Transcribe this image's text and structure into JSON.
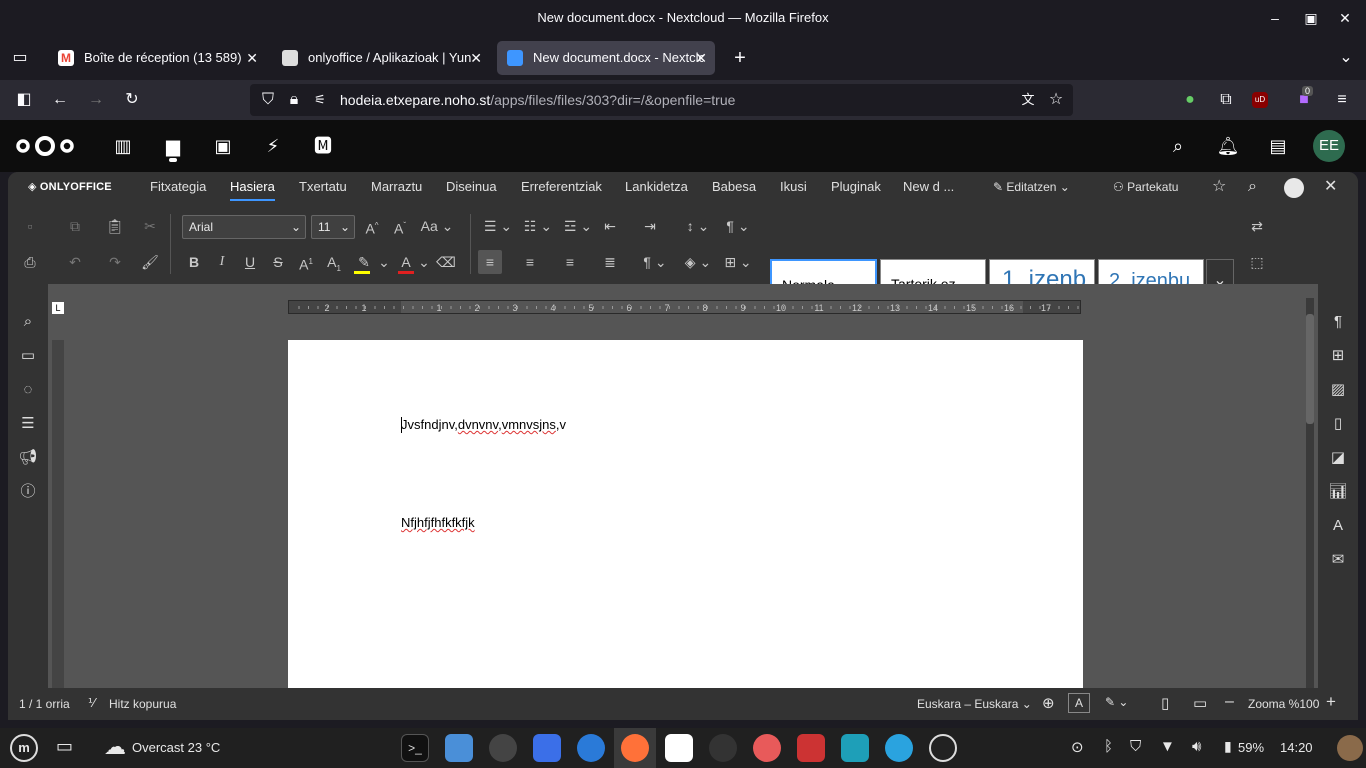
{
  "window": {
    "title": "New document.docx - Nextcloud — Mozilla Firefox"
  },
  "tabs": [
    {
      "label": "Boîte de réception (13 589)",
      "favicon_color": "#ea4335"
    },
    {
      "label": "onlyoffice / Aplikazioak | Yun",
      "favicon_color": "#bbbbbb"
    },
    {
      "label": "New document.docx - Nextcloud",
      "favicon_color": "#3e96ff"
    }
  ],
  "url": {
    "host": "hodeia.etxepare.noho.st",
    "path": "/apps/files/files/303?dir=/&openfile=true"
  },
  "extensions": {
    "badge_count": "0",
    "ublock_label": "uD"
  },
  "nextcloud": {
    "avatar_initials": "EE"
  },
  "onlyoffice": {
    "logo_text": "ONLYOFFICE",
    "menu": [
      "Fitxategia",
      "Hasiera",
      "Txertatu",
      "Marraztu",
      "Diseinua",
      "Erreferentziak",
      "Lankidetza",
      "Babesa",
      "Ikusi",
      "Pluginak",
      "New d ..."
    ],
    "active_menu": "Hasiera",
    "edit_mode": "Editatzen",
    "share": "Partekatu",
    "font_name": "Arial",
    "font_size": "11",
    "styles": [
      "Normala",
      "Tarterik ez",
      "1. izenb",
      "2. izenbu"
    ]
  },
  "document": {
    "line1_prefix": "Jvsfndjnv,",
    "line1_w2": "dvnvnv",
    "line1_sep": ",",
    "line1_w3": "vmnvsjns",
    "line1_suffix": ",v",
    "line2": "Nfjhfjfhfkfkfjk"
  },
  "ruler": {
    "top_numbers": [
      "2",
      "1",
      "1",
      "2",
      "3",
      "4",
      "5",
      "6",
      "7",
      "8",
      "9",
      "10",
      "11",
      "12",
      "13",
      "14",
      "15",
      "16",
      "17"
    ]
  },
  "status": {
    "page": "1 / 1 orria",
    "word_count": "Hitz kopurua",
    "language": "Euskara – Euskara",
    "zoom": "Zooma %100"
  },
  "taskbar": {
    "weather": "Overcast 23 °C",
    "battery": "59%",
    "time": "14:20"
  },
  "colors": {
    "accent": "#3e96ff",
    "highlight_yellow": "#ffff00",
    "font_red": "#e02020"
  }
}
